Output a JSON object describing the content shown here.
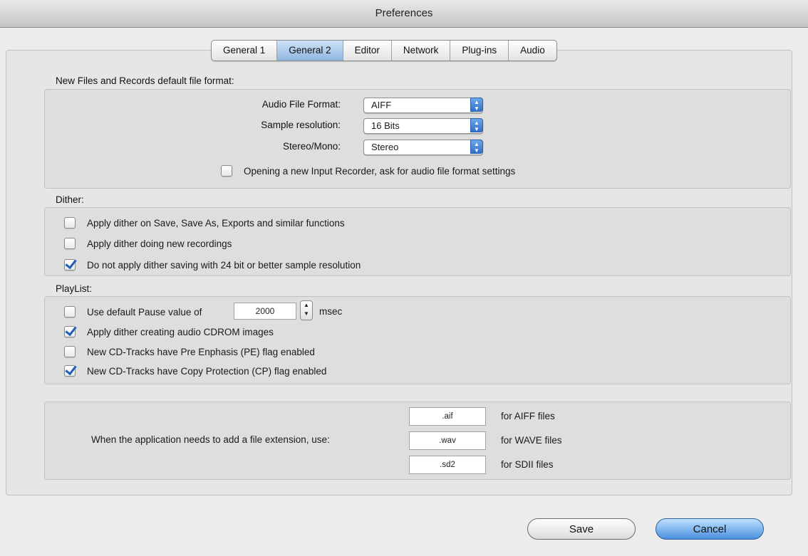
{
  "window": {
    "title": "Preferences"
  },
  "tabs": [
    {
      "label": "General 1",
      "active": false
    },
    {
      "label": "General 2",
      "active": true
    },
    {
      "label": "Editor",
      "active": false
    },
    {
      "label": "Network",
      "active": false
    },
    {
      "label": "Plug-ins",
      "active": false
    },
    {
      "label": "Audio",
      "active": false
    }
  ],
  "file_format": {
    "section_label": "New Files and Records default file format:",
    "audio_format_label": "Audio File Format:",
    "audio_format_value": "AIFF",
    "sample_res_label": "Sample resolution:",
    "sample_res_value": "16 Bits",
    "stereo_label": "Stereo/Mono:",
    "stereo_value": "Stereo",
    "ask_label": "Opening a new Input Recorder, ask for audio file format settings",
    "ask_checked": false
  },
  "dither": {
    "section_label": "Dither:",
    "items": [
      {
        "label": "Apply dither on Save, Save As, Exports and similar functions",
        "checked": false
      },
      {
        "label": "Apply dither doing new recordings",
        "checked": false
      },
      {
        "label": "Do not apply dither saving with 24 bit or better sample resolution",
        "checked": true
      }
    ]
  },
  "playlist": {
    "section_label": "PlayList:",
    "pause_label": "Use default Pause value of",
    "pause_value": "2000",
    "pause_unit": "msec",
    "pause_checked": false,
    "items": [
      {
        "label": "Apply dither creating audio CDROM images",
        "checked": true
      },
      {
        "label": "New CD-Tracks have Pre Enphasis (PE) flag enabled",
        "checked": false
      },
      {
        "label": "New CD-Tracks have Copy Protection (CP) flag enabled",
        "checked": true
      }
    ]
  },
  "extensions": {
    "label": "When the application needs to add a file extension, use:",
    "aiff_value": ".aif",
    "aiff_label": "for AIFF files",
    "wave_value": ".wav",
    "wave_label": "for WAVE files",
    "sdii_value": ".sd2",
    "sdii_label": "for SDII files"
  },
  "buttons": {
    "save": "Save",
    "cancel": "Cancel"
  }
}
